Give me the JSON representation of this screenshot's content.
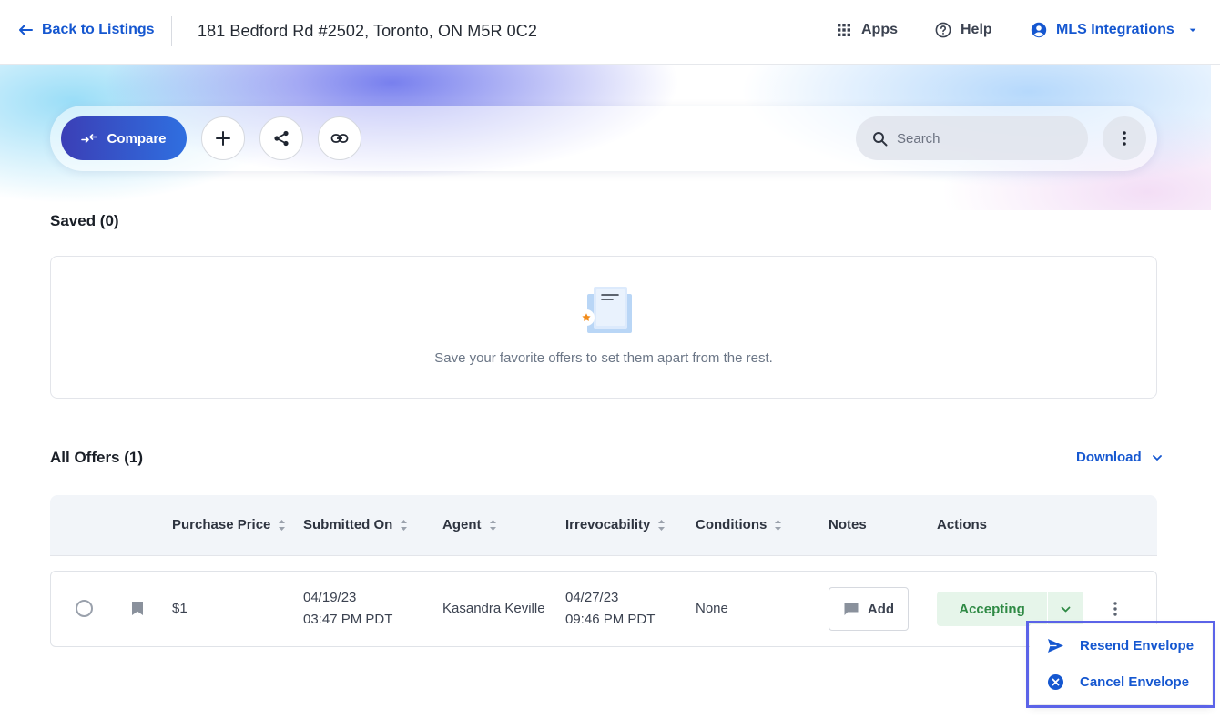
{
  "header": {
    "back_label": "Back to Listings",
    "address": "181 Bedford Rd #2502, Toronto, ON M5R 0C2",
    "apps_label": "Apps",
    "help_label": "Help",
    "account_label": "MLS Integrations",
    "icons": {
      "back": "arrow-left-icon",
      "apps": "grid-icon",
      "help": "question-circle-icon",
      "account": "user-circle-icon",
      "account_caret": "caret-down-icon"
    }
  },
  "toolbar": {
    "compare_label": "Compare",
    "search_placeholder": "Search",
    "icons": [
      "compare-arrows-icon",
      "plus-icon",
      "share-icon",
      "link-icon",
      "search-icon",
      "more-vertical-icon"
    ]
  },
  "saved": {
    "title": "Saved (0)",
    "empty_message": "Save your favorite offers to set them apart from the rest."
  },
  "offers": {
    "title": "All Offers (1)",
    "download_label": "Download",
    "columns": [
      {
        "label": "Purchase Price",
        "sortable": true
      },
      {
        "label": "Submitted On",
        "sortable": true
      },
      {
        "label": "Agent",
        "sortable": true
      },
      {
        "label": "Irrevocability",
        "sortable": true
      },
      {
        "label": "Conditions",
        "sortable": true
      },
      {
        "label": "Notes",
        "sortable": false
      },
      {
        "label": "Actions",
        "sortable": false
      }
    ],
    "rows": [
      {
        "purchase_price": "$1",
        "submitted_date": "04/19/23",
        "submitted_time": "03:47 PM PDT",
        "agent": "Kasandra Keville",
        "irrevocability_date": "04/27/23",
        "irrevocability_time": "09:46 PM PDT",
        "conditions": "None",
        "notes_label": "Add",
        "action_label": "Accepting"
      }
    ]
  },
  "actions_menu": {
    "items": [
      {
        "label": "Resend Envelope",
        "icon": "send-icon"
      },
      {
        "label": "Cancel Envelope",
        "icon": "close-circle-icon"
      }
    ]
  },
  "colors": {
    "accent": "#1557d0",
    "compare_gradient_start": "#3b3fb6",
    "compare_gradient_end": "#2f6fe0",
    "accepting_bg": "#e6f5ea",
    "accepting_text": "#2f8a45",
    "menu_highlight": "#5b63e8"
  }
}
